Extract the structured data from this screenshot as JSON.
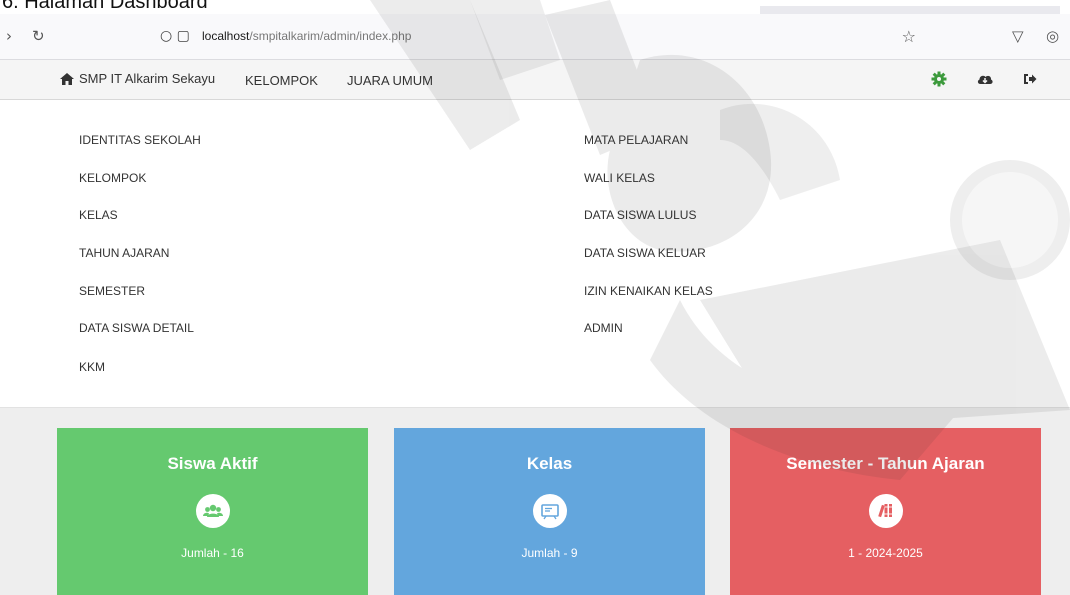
{
  "caption": {
    "text": "6. Halaman Dashboard"
  },
  "browser": {
    "url_host": "localhost",
    "url_path": "/smpitalkarim/admin/index.php"
  },
  "navbar": {
    "brand": "SMP IT Alkarim Sekayu",
    "links": [
      "KELOMPOK",
      "JUARA UMUM"
    ],
    "icons": [
      "gear-icon",
      "cloud-download-icon",
      "sign-out-icon"
    ]
  },
  "menu": {
    "left": [
      "IDENTITAS SEKOLAH",
      "KELOMPOK",
      "KELAS",
      "TAHUN AJARAN",
      "SEMESTER",
      "DATA SISWA DETAIL",
      "KKM"
    ],
    "right": [
      "MATA PELAJARAN",
      "WALI KELAS",
      "DATA SISWA LULUS",
      "DATA SISWA KELUAR",
      "IZIN KENAIKAN KELAS",
      "ADMIN"
    ]
  },
  "cards": [
    {
      "title": "Siswa Aktif",
      "subtitle": "Jumlah - 16",
      "color": "#65c96f",
      "icon": "users-icon"
    },
    {
      "title": "Kelas",
      "subtitle": "Jumlah - 9",
      "color": "#63a6dd",
      "icon": "class-icon"
    },
    {
      "title": "Semester - Tahun Ajaran",
      "subtitle": "1 - 2024-2025",
      "color": "#e55f62",
      "icon": "books-icon"
    }
  ]
}
